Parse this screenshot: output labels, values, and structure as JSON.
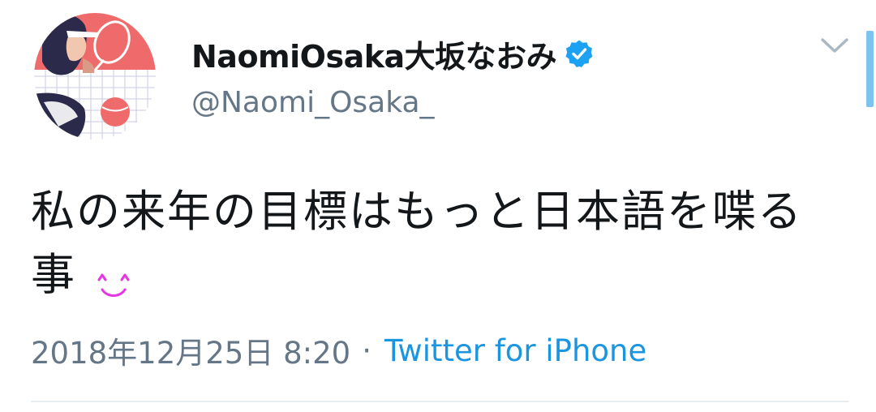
{
  "tweet": {
    "author": {
      "display_name": "NaomiOsaka大坂なおみ",
      "handle": "@Naomi_Osaka_",
      "verified": true,
      "avatar_icon": "illustrated-tennis-player-avatar"
    },
    "text": "私の来年の目標はもっと日本語を喋る事",
    "emoji": "smiling-face-icon",
    "timestamp": "2018年12月25日 8:20",
    "separator": "·",
    "source": "Twitter for iPhone",
    "menu_icon": "chevron-down-icon"
  },
  "colors": {
    "text": "#14171a",
    "secondary_text": "#657786",
    "link": "#1b95e0",
    "verified_badge": "#1da1f2",
    "emoji": "#e535e5",
    "divider": "#e6ecf0"
  }
}
